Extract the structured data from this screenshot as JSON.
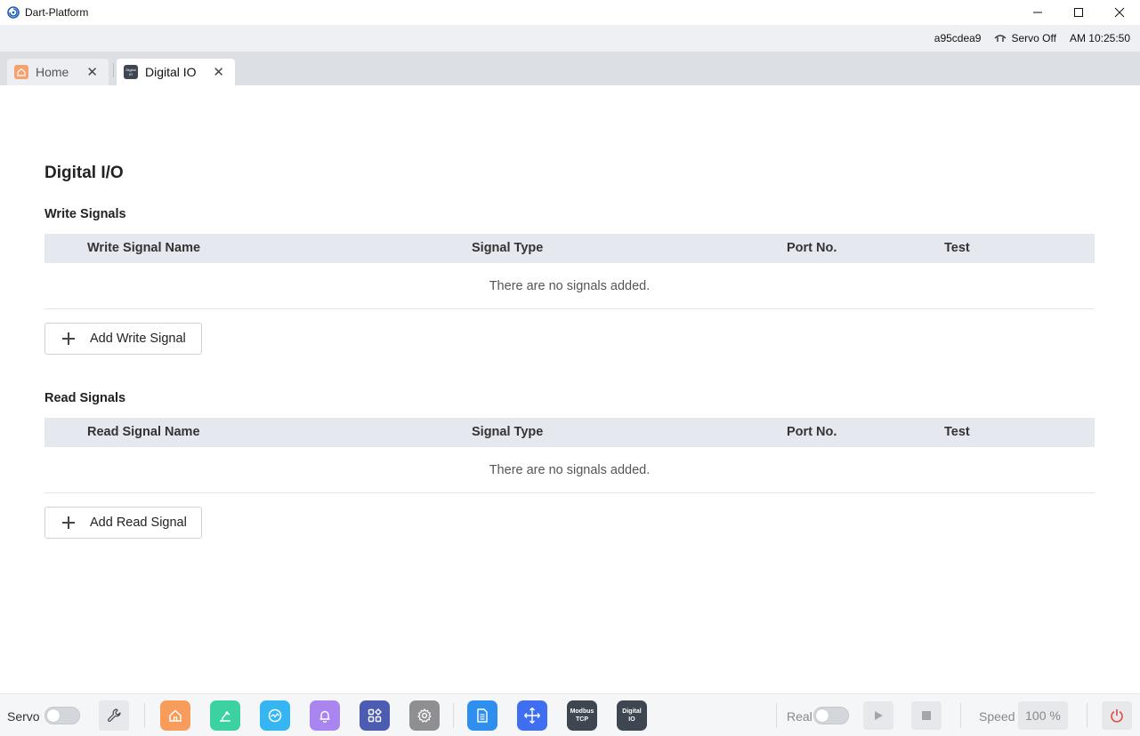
{
  "window": {
    "title": "Dart-Platform",
    "minimize": "—",
    "maximize": "☐",
    "close": "✕"
  },
  "status": {
    "device_id": "a95cdea9",
    "servo_status": "Servo Off",
    "time": "AM 10:25:50"
  },
  "tabs": [
    {
      "label": "Home",
      "close": "✕",
      "icon": "home-icon"
    },
    {
      "label": "Digital IO",
      "close": "✕",
      "icon": "digital-io-icon",
      "icon_text": "Digital IO"
    }
  ],
  "main": {
    "title": "Digital I/O",
    "write": {
      "title": "Write Signals",
      "columns": [
        "Write Signal Name",
        "Signal Type",
        "Port No.",
        "Test"
      ],
      "empty_text": "There are no signals added.",
      "add_label": "Add Write Signal"
    },
    "read": {
      "title": "Read Signals",
      "columns": [
        "Read Signal Name",
        "Signal Type",
        "Port No.",
        "Test"
      ],
      "empty_text": "There are no signals added.",
      "add_label": "Add Read Signal"
    }
  },
  "toolbar": {
    "servo_label": "Servo",
    "real_label": "Real",
    "speed_label": "Speed",
    "speed_value": "100 %",
    "apps": [
      {
        "name": "home-app",
        "color": "#f79c5a"
      },
      {
        "name": "robot-app",
        "color": "#3bd1a0"
      },
      {
        "name": "monitor-app",
        "color": "#35b6f2"
      },
      {
        "name": "notification-app",
        "color": "#a985f0"
      },
      {
        "name": "modules-app",
        "color": "#4c5cb0"
      },
      {
        "name": "settings-app",
        "color": "#8f8f93"
      },
      {
        "name": "document-app",
        "color": "#2e8fef"
      },
      {
        "name": "move-app",
        "color": "#3f6ff0"
      },
      {
        "name": "modbus-tcp-app",
        "color": "#3d4651",
        "text": "Modbus TCP"
      },
      {
        "name": "digital-io-app",
        "color": "#3d4651",
        "text": "Digital IO"
      }
    ]
  },
  "colors": {
    "accent_power": "#e0473f",
    "header_bg": "#e5e8ef"
  }
}
